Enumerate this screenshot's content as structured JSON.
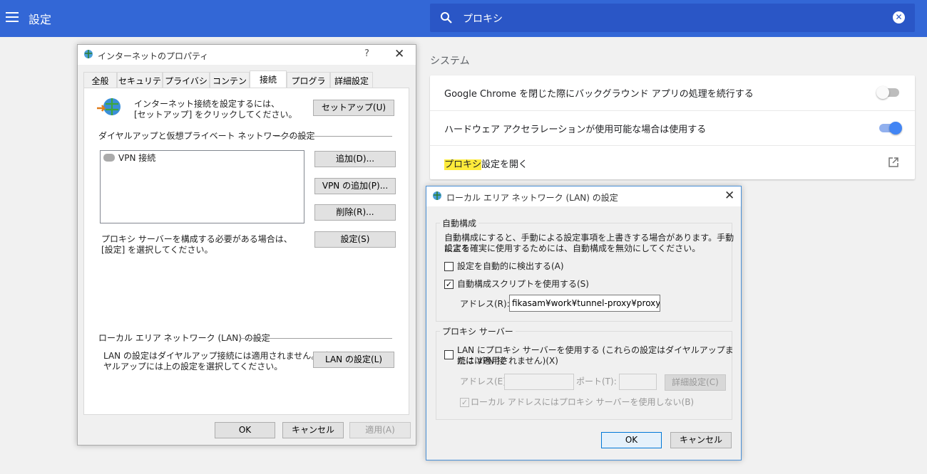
{
  "settings": {
    "title": "設定",
    "search_value": "プロキシ",
    "section": "システム",
    "rows": [
      {
        "label": "Google Chrome を閉じた際にバックグラウンド アプリの処理を続行する",
        "toggle": false
      },
      {
        "label": "ハードウェア アクセラレーションが使用可能な場合は使用する",
        "toggle": true
      }
    ],
    "proxy_row": {
      "highlight": "プロキシ",
      "rest": "設定を開く"
    },
    "accent": "#3367d6"
  },
  "inet": {
    "title": "インターネットのプロパティ",
    "help": "?",
    "tabs": [
      "全般",
      "セキュリティ",
      "プライバシー",
      "コンテンツ",
      "接続",
      "プログラム",
      "詳細設定"
    ],
    "active_tab": "接続",
    "setup_text_1": "インターネット接続を設定するには、",
    "setup_text_2": "[セットアップ] をクリックしてください。",
    "setup_button": "セットアップ(U)",
    "dialup_heading": "ダイヤルアップと仮想プライベート ネットワークの設定",
    "vpn_item": "VPN 接続",
    "add_button": "追加(D)...",
    "add_vpn_button": "VPN の追加(P)...",
    "remove_button": "削除(R)...",
    "proxy_text_1": "プロキシ サーバーを構成する必要がある場合は、",
    "proxy_text_2": "[設定] を選択してください。",
    "settings_button": "設定(S)",
    "lan_heading": "ローカル エリア ネットワーク (LAN) の設定",
    "lan_text_1": "LAN の設定はダイヤルアップ接続には適用されません。ダイ",
    "lan_text_2": "ヤルアップには上の設定を選択してください。",
    "lan_button": "LAN の設定(L)",
    "ok": "OK",
    "cancel": "キャンセル",
    "apply": "適用(A)"
  },
  "lan": {
    "title": "ローカル エリア ネットワーク (LAN) の設定",
    "auto_group": "自動構成",
    "auto_desc_1": "自動構成にすると、手動による設定事項を上書きする場合があります。手動による",
    "auto_desc_2": "設定を確実に使用するためには、自動構成を無効にしてください。",
    "auto_detect": "設定を自動的に検出する(A)",
    "auto_detect_checked": false,
    "use_script": "自動構成スクリプトを使用する(S)",
    "use_script_checked": true,
    "address_label": "アドレス(R):",
    "address_value": "fikasam¥work¥tunnel-proxy¥proxy.pac",
    "proxy_group": "プロキシ サーバー",
    "use_proxy_1": "LAN にプロキシ サーバーを使用する (これらの設定はダイヤルアップまたは VPN 接",
    "use_proxy_2": "続には適用されません)(X)",
    "use_proxy_checked": false,
    "proxy_address_label": "アドレス(E):",
    "port_label": "ポート(T):",
    "advanced_button": "詳細設定(C)",
    "bypass_local": "ローカル アドレスにはプロキシ サーバーを使用しない(B)",
    "bypass_local_checked": true,
    "ok": "OK",
    "cancel": "キャンセル"
  }
}
